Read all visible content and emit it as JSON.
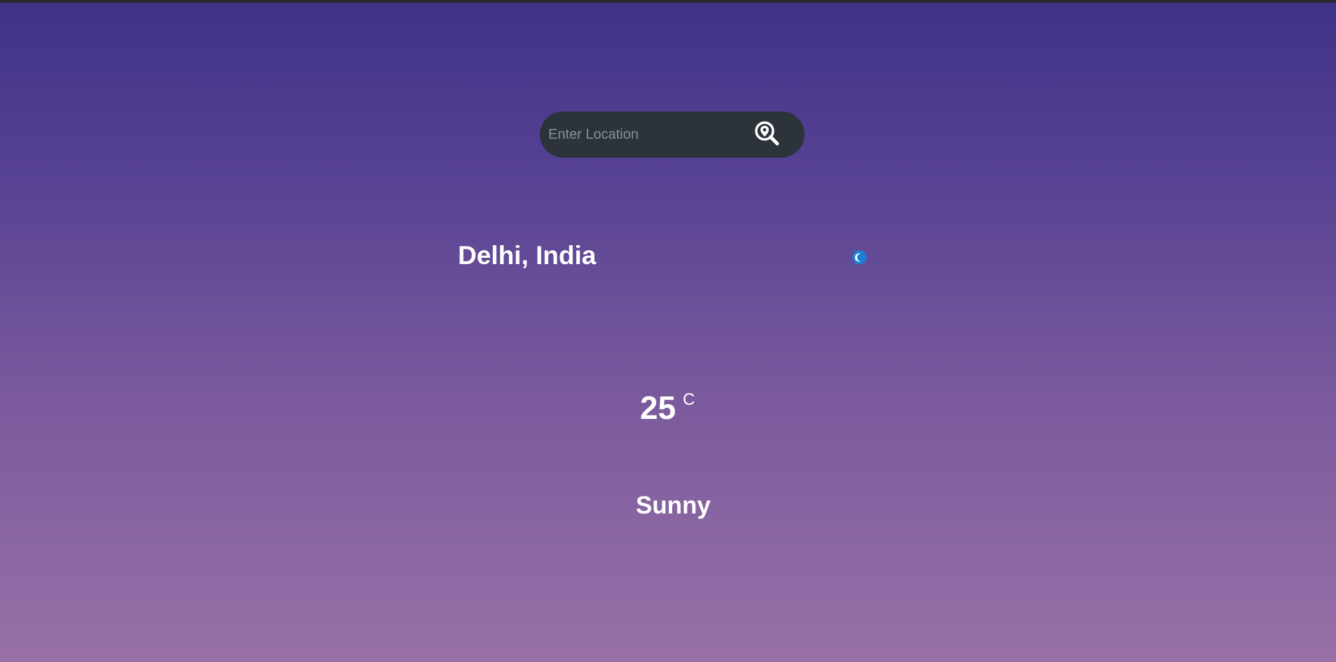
{
  "search": {
    "placeholder": "Enter Location",
    "value": "",
    "button_icon": "location-search-icon"
  },
  "weather": {
    "location": "Delhi, India",
    "icon": "moon-icon",
    "temperature": "25",
    "unit": "C",
    "condition": "Sunny"
  },
  "colors": {
    "gradient_top": "#3f3289",
    "gradient_bottom": "#9870a6",
    "search_bg": "#2d333b",
    "icon_accent": "#1a7fd6",
    "text": "#ffffff"
  }
}
